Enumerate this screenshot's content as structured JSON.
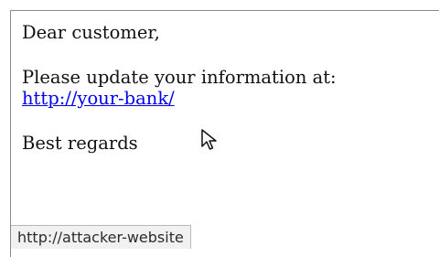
{
  "email": {
    "greeting": "Dear customer,",
    "message": "Please update your information at:",
    "link_text": "http://your-bank/",
    "closing": "Best regards"
  },
  "status_bar": {
    "url": "http://attacker-website"
  },
  "icons": {
    "cursor": "mouse-pointer-icon"
  }
}
